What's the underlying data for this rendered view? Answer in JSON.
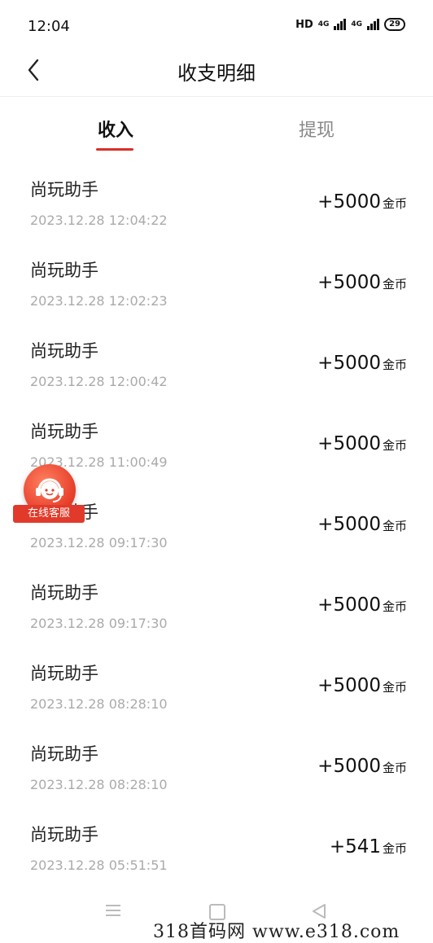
{
  "status_bar": {
    "time": "12:04",
    "network": "HD",
    "signal_1": "4G",
    "signal_2": "4G",
    "battery": "29"
  },
  "header": {
    "title": "收支明细"
  },
  "tabs": [
    {
      "label": "收入",
      "active": true
    },
    {
      "label": "提现",
      "active": false
    }
  ],
  "records": [
    {
      "name": "尚玩助手",
      "time": "2023.12.28 12:04:22",
      "amount": "+5000",
      "unit": "金币"
    },
    {
      "name": "尚玩助手",
      "time": "2023.12.28 12:02:23",
      "amount": "+5000",
      "unit": "金币"
    },
    {
      "name": "尚玩助手",
      "time": "2023.12.28 12:00:42",
      "amount": "+5000",
      "unit": "金币"
    },
    {
      "name": "尚玩助手",
      "time": "2023.12.28 11:00:49",
      "amount": "+5000",
      "unit": "金币"
    },
    {
      "name": "尚玩助手",
      "time": "2023.12.28 09:17:30",
      "amount": "+5000",
      "unit": "金币"
    },
    {
      "name": "尚玩助手",
      "time": "2023.12.28 09:17:30",
      "amount": "+5000",
      "unit": "金币"
    },
    {
      "name": "尚玩助手",
      "time": "2023.12.28 08:28:10",
      "amount": "+5000",
      "unit": "金币"
    },
    {
      "name": "尚玩助手",
      "time": "2023.12.28 08:28:10",
      "amount": "+5000",
      "unit": "金币"
    },
    {
      "name": "尚玩助手",
      "time": "2023.12.28 05:51:51",
      "amount": "+541",
      "unit": "金币"
    }
  ],
  "customer_service": {
    "label": "在线客服",
    "icon": "headset-icon"
  },
  "watermark": "318首码网  www.e318.com",
  "colors": {
    "accent": "#d9302a",
    "service": "#e23a2a"
  }
}
